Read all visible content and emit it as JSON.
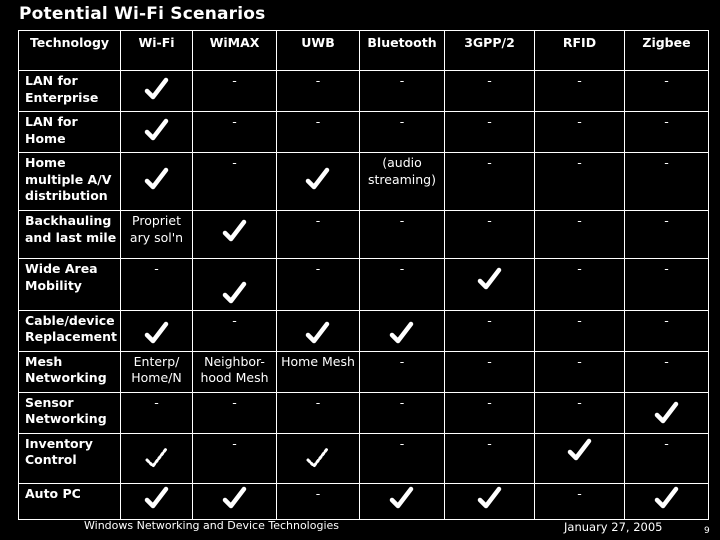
{
  "slide": {
    "title": "Potential Wi-Fi Scenarios",
    "footer": "Windows Networking and Device Technologies",
    "date": "January 27, 2005",
    "page_number": "9"
  },
  "table": {
    "columns": [
      "Technology",
      "Wi-Fi",
      "WiMAX",
      "UWB",
      "Bluetooth",
      "3GPP/2",
      "RFID",
      "Zigbee"
    ],
    "rows": [
      {
        "label": "LAN for Enterprise",
        "cells": [
          {
            "type": "check"
          },
          {
            "type": "dash",
            "text": "-"
          },
          {
            "type": "dash",
            "text": "-"
          },
          {
            "type": "dash",
            "text": "-"
          },
          {
            "type": "dash",
            "text": "-"
          },
          {
            "type": "dash",
            "text": "-"
          },
          {
            "type": "dash",
            "text": "-"
          }
        ]
      },
      {
        "label": "LAN for Home",
        "cells": [
          {
            "type": "check"
          },
          {
            "type": "dash",
            "text": "-"
          },
          {
            "type": "dash",
            "text": "-"
          },
          {
            "type": "dash",
            "text": "-"
          },
          {
            "type": "dash",
            "text": "-"
          },
          {
            "type": "dash",
            "text": "-"
          },
          {
            "type": "dash",
            "text": "-"
          }
        ]
      },
      {
        "label": "Home multiple A/V distribution",
        "cells": [
          {
            "type": "check"
          },
          {
            "type": "dash",
            "text": "-"
          },
          {
            "type": "check"
          },
          {
            "type": "text",
            "text": "(audio streaming)"
          },
          {
            "type": "dash",
            "text": "-"
          },
          {
            "type": "dash",
            "text": "-"
          },
          {
            "type": "dash",
            "text": "-"
          }
        ]
      },
      {
        "label": "Backhauling and last mile",
        "cells": [
          {
            "type": "text",
            "text": "Propriet ary sol'n"
          },
          {
            "type": "check"
          },
          {
            "type": "dash",
            "text": "-"
          },
          {
            "type": "dash",
            "text": "-"
          },
          {
            "type": "dash",
            "text": "-"
          },
          {
            "type": "dash",
            "text": "-"
          },
          {
            "type": "dash",
            "text": "-"
          }
        ]
      },
      {
        "label": "Wide Area Mobility",
        "cells": [
          {
            "type": "dash",
            "text": "-"
          },
          {
            "type": "check"
          },
          {
            "type": "dash",
            "text": "-"
          },
          {
            "type": "dash",
            "text": "-"
          },
          {
            "type": "check"
          },
          {
            "type": "dash",
            "text": "-"
          },
          {
            "type": "dash",
            "text": "-"
          }
        ]
      },
      {
        "label": "Cable/device Replacement",
        "cells": [
          {
            "type": "check"
          },
          {
            "type": "dash",
            "text": "-"
          },
          {
            "type": "check"
          },
          {
            "type": "check"
          },
          {
            "type": "dash",
            "text": "-"
          },
          {
            "type": "dash",
            "text": "-"
          },
          {
            "type": "dash",
            "text": "-"
          }
        ]
      },
      {
        "label": "Mesh Networking",
        "cells": [
          {
            "type": "text",
            "text": "Enterp/ Home/N"
          },
          {
            "type": "text",
            "text": "Neighbor-hood Mesh"
          },
          {
            "type": "text",
            "text": "Home Mesh"
          },
          {
            "type": "dash",
            "text": "-"
          },
          {
            "type": "dash",
            "text": "-"
          },
          {
            "type": "dash",
            "text": "-"
          },
          {
            "type": "dash",
            "text": "-"
          }
        ]
      },
      {
        "label": "Sensor Networking",
        "cells": [
          {
            "type": "dash",
            "text": "-"
          },
          {
            "type": "dash",
            "text": "-"
          },
          {
            "type": "dash",
            "text": "-"
          },
          {
            "type": "dash",
            "text": "-"
          },
          {
            "type": "dash",
            "text": "-"
          },
          {
            "type": "dash",
            "text": "-"
          },
          {
            "type": "check"
          }
        ]
      },
      {
        "label": "Inventory Control",
        "cells": [
          {
            "type": "partial-check"
          },
          {
            "type": "dash",
            "text": "-"
          },
          {
            "type": "partial-check"
          },
          {
            "type": "dash",
            "text": "-"
          },
          {
            "type": "dash",
            "text": "-"
          },
          {
            "type": "check"
          },
          {
            "type": "dash",
            "text": "-"
          }
        ]
      },
      {
        "label": "Auto PC",
        "cells": [
          {
            "type": "check"
          },
          {
            "type": "check"
          },
          {
            "type": "dash",
            "text": "-"
          },
          {
            "type": "check"
          },
          {
            "type": "check"
          },
          {
            "type": "dash",
            "text": "-"
          },
          {
            "type": "check"
          }
        ]
      }
    ]
  }
}
